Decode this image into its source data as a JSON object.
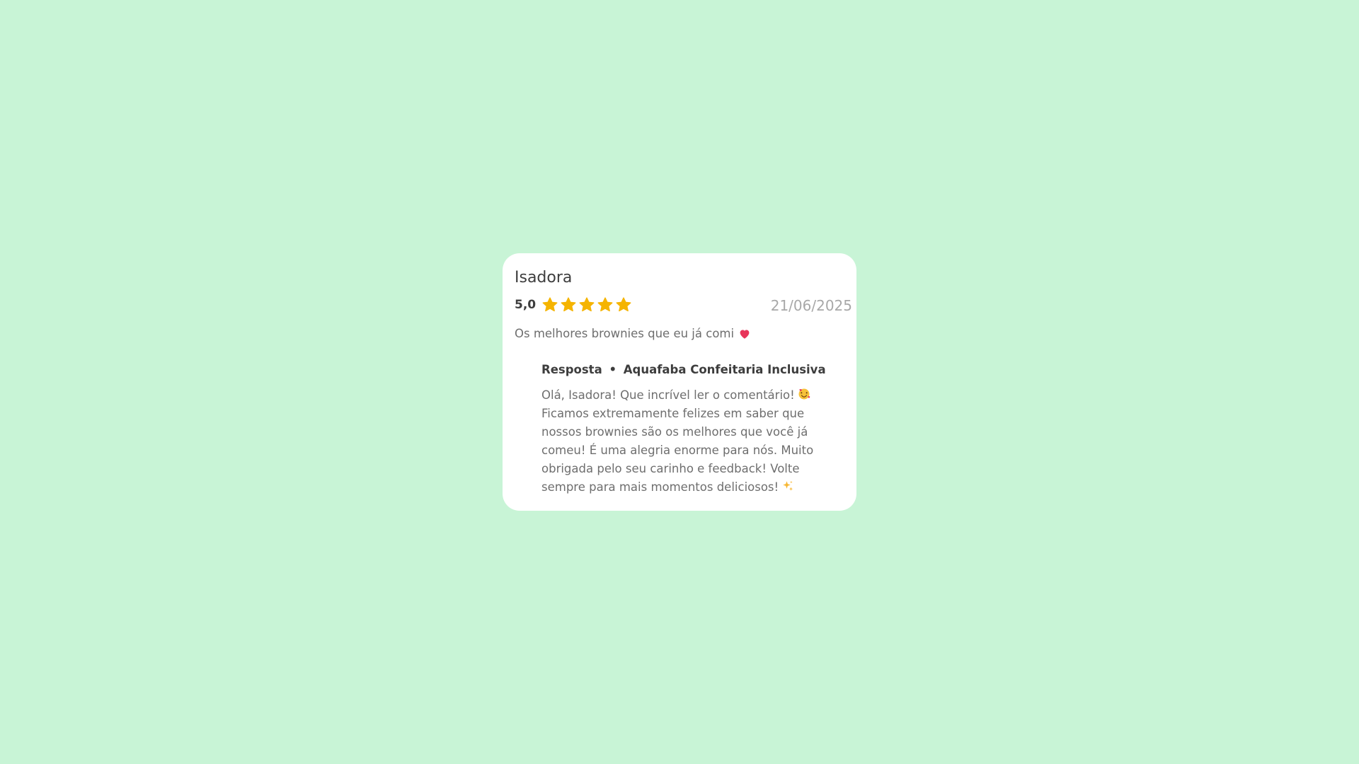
{
  "review": {
    "reviewer_name": "Isadora",
    "rating_text": "5,0",
    "rating": 5,
    "max_rating": 5,
    "date": "21/06/2025",
    "comment": "Os melhores brownies que eu já comi",
    "comment_icon": "heart-icon"
  },
  "reply": {
    "label": "Resposta",
    "separator": "•",
    "business_name": "Aquafaba Confeitaria Inclusiva",
    "lines": [
      "Olá, Isadora! Que incrível ler o comentário!",
      "Ficamos extremamente felizes em saber que",
      "nossos brownies são os melhores que você já",
      "comeu! É uma alegria enorme para nós. Muito",
      "obrigada pelo seu carinho e feedback! Volte",
      "sempre para mais momentos deliciosos!"
    ],
    "icons": [
      "smiling-face-with-hearts-icon",
      "sparkles-icon"
    ]
  },
  "colors": {
    "background": "#c8f4d6",
    "card": "#ffffff",
    "star": "#f5b400",
    "heart": "#e8345a"
  }
}
